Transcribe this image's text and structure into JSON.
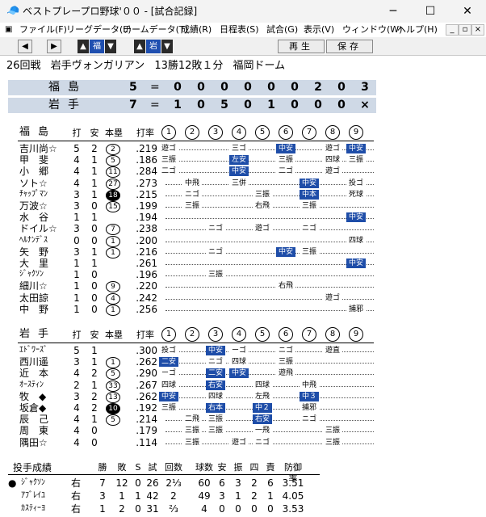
{
  "window": {
    "title": "ベストプレープロ野球'００ - [試合記録]",
    "minimize": "─",
    "maximize": "☐",
    "close": "✕",
    "app_icon": "baseball-cap-icon"
  },
  "menu": {
    "items": [
      "ファイル(F)",
      "リーグデータ(L)",
      "チームデータ(T)",
      "成績(R)",
      "日程表(S)",
      "試合(G)",
      "表示(V)",
      "ウィンドウ(W)",
      "ヘルプ(H)"
    ],
    "mdi": [
      "_",
      "▫",
      "×"
    ]
  },
  "toolbar": {
    "prev": "◀",
    "next": "▶",
    "up1": "▲",
    "team1": "福",
    "down1": "▼",
    "up2": "▲",
    "team2": "岩",
    "down2": "▼",
    "replay": "再生",
    "save": "保存"
  },
  "game": {
    "round": "26回戦",
    "team": "岩手ヴォンガリアン",
    "record": "13勝12敗１分",
    "stadium": "福岡ドーム"
  },
  "scoreboard": [
    {
      "team": "福島",
      "total": "5",
      "eq": "=",
      "innings": [
        "0",
        "0",
        "0",
        "0",
        "0",
        "0",
        "2",
        "0",
        "3"
      ]
    },
    {
      "team": "岩手",
      "total": "7",
      "eq": "=",
      "innings": [
        "1",
        "0",
        "5",
        "0",
        "1",
        "0",
        "0",
        "0",
        "×"
      ]
    }
  ],
  "columns": {
    "h1": "打",
    "h2": "安",
    "h3": "本塁",
    "h4": "打率",
    "innings": [
      "1",
      "2",
      "3",
      "4",
      "5",
      "6",
      "7",
      "8",
      "9"
    ]
  },
  "fukushima": {
    "team": "福島",
    "rows": [
      {
        "name": "吉川尚☆",
        "ab": "5",
        "h": "2",
        "hr": "2",
        "hrf": false,
        "avg": ".219",
        "cells": [
          [
            1,
            "遊ゴ",
            false
          ],
          [
            4,
            "三ゴ",
            false
          ],
          [
            6,
            "中安",
            true
          ],
          [
            8,
            "遊ゴ",
            false
          ],
          [
            9,
            "中安",
            true
          ]
        ]
      },
      {
        "name": "甲　斐",
        "ab": "4",
        "h": "1",
        "hr": "5",
        "hrf": false,
        "avg": ".186",
        "cells": [
          [
            1,
            "三振",
            false
          ],
          [
            4,
            "左安",
            true
          ],
          [
            6,
            "三振",
            false
          ],
          [
            8,
            "四球",
            false
          ],
          [
            9,
            "三振",
            false
          ]
        ]
      },
      {
        "name": "小　郷",
        "ab": "4",
        "h": "1",
        "hr": "11",
        "hrf": false,
        "avg": ".284",
        "cells": [
          [
            1,
            "二ゴ",
            false
          ],
          [
            4,
            "中安",
            true
          ],
          [
            6,
            "二ゴ",
            false
          ],
          [
            8,
            "遊ゴ",
            false
          ]
        ]
      },
      {
        "name": "ソト☆",
        "ab": "4",
        "h": "1",
        "hr": "27",
        "hrf": false,
        "avg": ".273",
        "cells": [
          [
            2,
            "中飛",
            false
          ],
          [
            4,
            "三併",
            false
          ],
          [
            7,
            "中安",
            true
          ],
          [
            9,
            "投ゴ",
            false
          ]
        ]
      },
      {
        "name": "ﾁｬｯﾌﾟﾏﾝ",
        "ab": "3",
        "h": "1",
        "hr": "18",
        "hrf": true,
        "avg": ".215",
        "cells": [
          [
            2,
            "ニゴ",
            false
          ],
          [
            5,
            "三振",
            false
          ],
          [
            7,
            "中本",
            true
          ],
          [
            9,
            "死球",
            false
          ]
        ]
      },
      {
        "name": "万波☆",
        "ab": "3",
        "h": "0",
        "hr": "15",
        "hrf": false,
        "avg": ".199",
        "cells": [
          [
            2,
            "三振",
            false
          ],
          [
            5,
            "右飛",
            false
          ],
          [
            7,
            "三振",
            false
          ]
        ]
      },
      {
        "name": "水　谷",
        "ab": "1",
        "h": "1",
        "hr": "",
        "hrf": false,
        "avg": ".194",
        "cells": [
          [
            9,
            "中安",
            true
          ]
        ]
      },
      {
        "name": "ドイル☆",
        "ab": "3",
        "h": "0",
        "hr": "7",
        "hrf": false,
        "avg": ".238",
        "cells": [
          [
            3,
            "ニゴ",
            false
          ],
          [
            5,
            "遊ゴ",
            false
          ],
          [
            7,
            "ニゴ",
            false
          ]
        ]
      },
      {
        "name": "ﾍﾙﾅﾝﾃﾞｽ",
        "ab": "0",
        "h": "0",
        "hr": "1",
        "hrf": false,
        "avg": ".200",
        "cells": [
          [
            9,
            "四球",
            false
          ]
        ]
      },
      {
        "name": "矢　野",
        "ab": "3",
        "h": "1",
        "hr": "1",
        "hrf": false,
        "avg": ".216",
        "cells": [
          [
            3,
            "ニゴ",
            false
          ],
          [
            6,
            "中安",
            true
          ],
          [
            7,
            "三振",
            false
          ]
        ]
      },
      {
        "name": "大　里",
        "ab": "1",
        "h": "1",
        "hr": "",
        "hrf": false,
        "avg": ".261",
        "cells": [
          [
            9,
            "中安",
            true
          ]
        ]
      },
      {
        "name": "ｼﾞｬｸｿﾝ",
        "ab": "1",
        "h": "0",
        "hr": "",
        "hrf": false,
        "avg": ".196",
        "cells": [
          [
            3,
            "三振",
            false
          ]
        ]
      },
      {
        "name": "細川☆",
        "ab": "1",
        "h": "0",
        "hr": "9",
        "hrf": false,
        "avg": ".220",
        "cells": [
          [
            6,
            "右飛",
            false
          ]
        ]
      },
      {
        "name": "太田諒",
        "ab": "1",
        "h": "0",
        "hr": "4",
        "hrf": false,
        "avg": ".242",
        "cells": [
          [
            8,
            "遊ゴ",
            false
          ]
        ]
      },
      {
        "name": "中　野",
        "ab": "1",
        "h": "0",
        "hr": "1",
        "hrf": false,
        "avg": ".256",
        "cells": [
          [
            9,
            "捕邪",
            false
          ]
        ]
      }
    ]
  },
  "iwate": {
    "team": "岩手",
    "rows": [
      {
        "name": "ｴﾄﾞﾜｰｽﾞ",
        "ab": "5",
        "h": "1",
        "hr": "",
        "hrf": false,
        "avg": ".300",
        "cells": [
          [
            1,
            "投ゴ",
            false
          ],
          [
            3,
            "中安",
            true
          ],
          [
            4,
            "ーゴ",
            false
          ],
          [
            6,
            "ニゴ",
            false
          ],
          [
            8,
            "遊直",
            false
          ]
        ]
      },
      {
        "name": "西川遥",
        "ab": "3",
        "h": "1",
        "hr": "1",
        "hrf": false,
        "avg": ".262",
        "cells": [
          [
            1,
            "二安",
            true
          ],
          [
            3,
            "ニゴ",
            false
          ],
          [
            4,
            "四球",
            false
          ],
          [
            6,
            "三振",
            false
          ]
        ]
      },
      {
        "name": "近　本",
        "ab": "4",
        "h": "2",
        "hr": "5",
        "hrf": false,
        "avg": ".290",
        "cells": [
          [
            1,
            "ーゴ",
            false
          ],
          [
            3,
            "二安",
            true
          ],
          [
            4,
            "中安",
            true
          ],
          [
            6,
            "遊飛",
            false
          ]
        ]
      },
      {
        "name": "ｵｰｽﾃｨﾝ",
        "ab": "2",
        "h": "1",
        "hr": "33",
        "hrf": false,
        "avg": ".267",
        "cells": [
          [
            1,
            "四球",
            false
          ],
          [
            3,
            "右安",
            true
          ],
          [
            5,
            "四球",
            false
          ],
          [
            7,
            "中飛",
            false
          ]
        ]
      },
      {
        "name": "牧　◆",
        "ab": "3",
        "h": "2",
        "hr": "13",
        "hrf": false,
        "avg": ".262",
        "cells": [
          [
            1,
            "中安",
            true
          ],
          [
            3,
            "四球",
            false
          ],
          [
            5,
            "左飛",
            false
          ],
          [
            7,
            "中３",
            true
          ]
        ]
      },
      {
        "name": "坂倉◆",
        "ab": "4",
        "h": "2",
        "hr": "10",
        "hrf": true,
        "avg": ".192",
        "cells": [
          [
            1,
            "三振",
            false
          ],
          [
            3,
            "右本",
            true
          ],
          [
            5,
            "中２",
            true
          ],
          [
            7,
            "捕邪",
            false
          ]
        ]
      },
      {
        "name": "辰　己",
        "ab": "4",
        "h": "1",
        "hr": "5",
        "hrf": false,
        "avg": ".214",
        "cells": [
          [
            2,
            "二飛",
            false
          ],
          [
            3,
            "三振",
            false
          ],
          [
            5,
            "右安",
            true
          ],
          [
            7,
            "ニゴ",
            false
          ]
        ]
      },
      {
        "name": "周　東",
        "ab": "4",
        "h": "0",
        "hr": "",
        "hrf": false,
        "avg": ".179",
        "cells": [
          [
            2,
            "三振",
            false
          ],
          [
            3,
            "三振",
            false
          ],
          [
            5,
            "一飛",
            false
          ],
          [
            8,
            "三振",
            false
          ]
        ]
      },
      {
        "name": "隅田☆",
        "ab": "4",
        "h": "0",
        "hr": "",
        "hrf": false,
        "avg": ".114",
        "cells": [
          [
            2,
            "三振",
            false
          ],
          [
            4,
            "遊ゴ",
            false
          ],
          [
            5,
            "ニゴ",
            false
          ],
          [
            8,
            "三振",
            false
          ]
        ]
      }
    ]
  },
  "pitching": {
    "title": "投手成績",
    "headers": [
      "勝",
      "敗",
      "S",
      "試",
      "回数",
      "球数",
      "安",
      "振",
      "四",
      "責",
      "防御率"
    ],
    "rows": [
      {
        "marker": "●",
        "name": "ｼﾞｬｸｿﾝ",
        "hand": "右",
        "w": "7",
        "l": "12",
        "s": "0",
        "g": "26",
        "ip": "2⅓",
        "np": "60",
        "h": "6",
        "k": "3",
        "bb": "2",
        "er": "6",
        "era": "3.51"
      },
      {
        "marker": "",
        "name": "ｱﾌﾞﾚｲﾕ",
        "hand": "右",
        "w": "3",
        "l": "1",
        "s": "1",
        "g": "42",
        "ip": "2",
        "np": "49",
        "h": "3",
        "k": "1",
        "bb": "2",
        "er": "1",
        "era": "4.05"
      },
      {
        "marker": "",
        "name": "ｶｽﾃｨｰﾖ",
        "hand": "右",
        "w": "1",
        "l": "2",
        "s": "0",
        "g": "31",
        "ip": "⅔",
        "np": "4",
        "h": "0",
        "k": "0",
        "bb": "0",
        "er": "0",
        "era": "3.53"
      }
    ]
  }
}
